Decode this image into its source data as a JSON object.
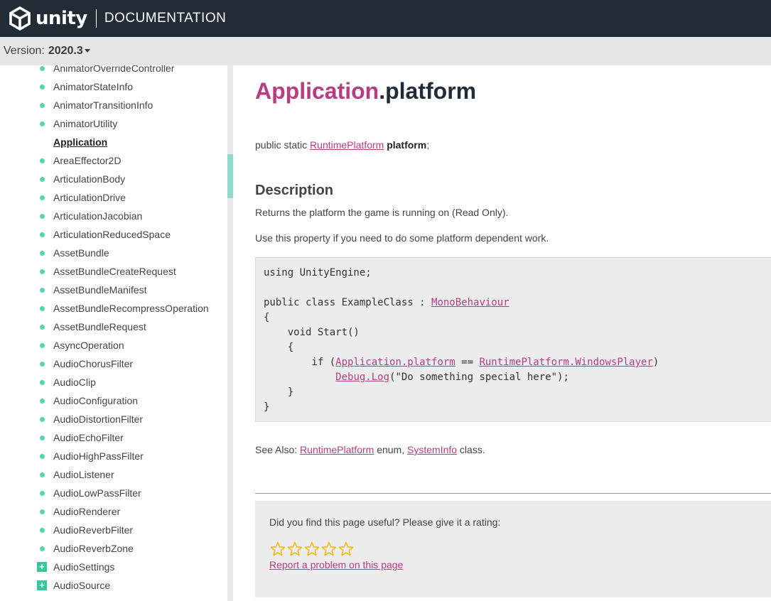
{
  "header": {
    "logo_word": "unity",
    "section": "DOCUMENTATION"
  },
  "version": {
    "label": "Version:",
    "value": "2020.3"
  },
  "sidebar": {
    "items": [
      {
        "label": "AnimatorOverrideController",
        "marker": "bullet"
      },
      {
        "label": "AnimatorStateInfo",
        "marker": "bullet"
      },
      {
        "label": "AnimatorTransitionInfo",
        "marker": "bullet"
      },
      {
        "label": "AnimatorUtility",
        "marker": "bullet"
      },
      {
        "label": "Application",
        "marker": "none",
        "active": true
      },
      {
        "label": "AreaEffector2D",
        "marker": "bullet"
      },
      {
        "label": "ArticulationBody",
        "marker": "bullet"
      },
      {
        "label": "ArticulationDrive",
        "marker": "bullet"
      },
      {
        "label": "ArticulationJacobian",
        "marker": "bullet"
      },
      {
        "label": "ArticulationReducedSpace",
        "marker": "bullet"
      },
      {
        "label": "AssetBundle",
        "marker": "bullet"
      },
      {
        "label": "AssetBundleCreateRequest",
        "marker": "bullet"
      },
      {
        "label": "AssetBundleManifest",
        "marker": "bullet"
      },
      {
        "label": "AssetBundleRecompressOperation",
        "marker": "bullet"
      },
      {
        "label": "AssetBundleRequest",
        "marker": "bullet"
      },
      {
        "label": "AsyncOperation",
        "marker": "bullet"
      },
      {
        "label": "AudioChorusFilter",
        "marker": "bullet"
      },
      {
        "label": "AudioClip",
        "marker": "bullet"
      },
      {
        "label": "AudioConfiguration",
        "marker": "bullet"
      },
      {
        "label": "AudioDistortionFilter",
        "marker": "bullet"
      },
      {
        "label": "AudioEchoFilter",
        "marker": "bullet"
      },
      {
        "label": "AudioHighPassFilter",
        "marker": "bullet"
      },
      {
        "label": "AudioListener",
        "marker": "bullet"
      },
      {
        "label": "AudioLowPassFilter",
        "marker": "bullet"
      },
      {
        "label": "AudioRenderer",
        "marker": "bullet"
      },
      {
        "label": "AudioReverbFilter",
        "marker": "bullet"
      },
      {
        "label": "AudioReverbZone",
        "marker": "bullet"
      },
      {
        "label": "AudioSettings",
        "marker": "plus"
      },
      {
        "label": "AudioSource",
        "marker": "plus"
      }
    ]
  },
  "page": {
    "title_class": "Application",
    "title_member": ".platform",
    "signature": {
      "prefix": "public static ",
      "type_link": "RuntimePlatform",
      "name": "platform",
      "suffix": ";"
    },
    "description_heading": "Description",
    "description": "Returns the platform the game is running on (Read Only).",
    "usage": "Use this property if you need to do some platform dependent work.",
    "code": {
      "line1": "using UnityEngine;",
      "line3_prefix": "public class ExampleClass : ",
      "line3_link": "MonoBehaviour",
      "line4": "{",
      "line5": "    void Start()",
      "line6": "    {",
      "line7_prefix": "        if (",
      "line7_link1": "Application.platform",
      "line7_mid": " == ",
      "line7_link2": "RuntimePlatform.WindowsPlayer",
      "line7_suffix": ")",
      "line8_indent": "            ",
      "line8_link": "Debug.Log",
      "line8_suffix": "(\"Do something special here\");",
      "line9": "    }",
      "line10": "}"
    },
    "see_also": {
      "prefix": "See Also: ",
      "link1": "RuntimePlatform",
      "mid": " enum, ",
      "link2": "SystemInfo",
      "suffix": " class."
    },
    "rating": {
      "question": "Did you find this page useful? Please give it a rating:",
      "stars": 5,
      "star_color": "#f5b400",
      "report_link": "Report a problem on this page"
    }
  },
  "colors": {
    "topbar": "#222c37",
    "accent": "#b83c82",
    "bullet": "#55d6b0"
  }
}
